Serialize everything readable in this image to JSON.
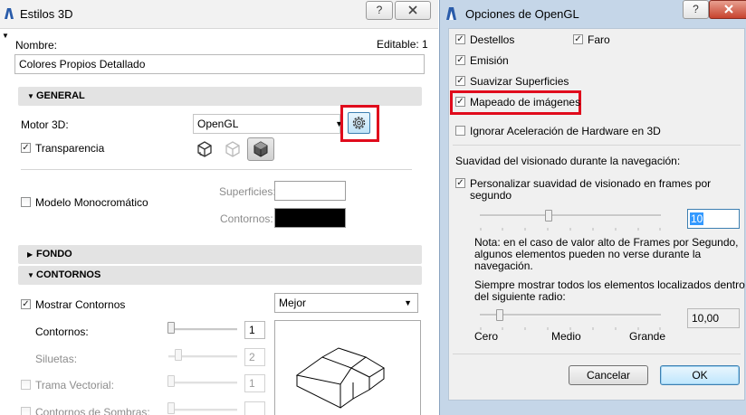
{
  "estilos": {
    "title": "Estilos 3D",
    "help_label": "?",
    "nombre_label": "Nombre:",
    "editable_label": "Editable: 1",
    "nombre_value": "Colores Propios Detallado",
    "general": {
      "header": "GENERAL",
      "motor_label": "Motor 3D:",
      "motor_value": "OpenGL",
      "transparencia_label": "Transparencia",
      "transparencia_checked": "✓",
      "monocromatico_label": "Modelo Monocromático",
      "superficies_label": "Superficies:",
      "contornos_label": "Contornos:",
      "superficies_color": "#ffffff",
      "contornos_color": "#000000"
    },
    "fondo_header": "FONDO",
    "contornos": {
      "header": "CONTORNOS",
      "mostrar_label": "Mostrar Contornos",
      "mostrar_checked": "✓",
      "quality_value": "Mejor",
      "contornos_label": "Contornos:",
      "contornos_value": "1",
      "siluetas_label": "Siluetas:",
      "siluetas_value": "2",
      "trama_label": "Trama Vectorial:",
      "trama_value": "1",
      "sombras_label": "Contornos de Sombras:"
    }
  },
  "opengl": {
    "title": "Opciones de OpenGL",
    "help_label": "?",
    "close_label": "X",
    "destellos_label": "Destellos",
    "faro_label": "Faro",
    "emision_label": "Emisión",
    "suavizar_label": "Suavizar Superficies",
    "mapeado_label": "Mapeado de imágenes",
    "ignorar_label": "Ignorar Aceleración de Hardware en 3D",
    "check_mark": "✓",
    "suavidad_heading": "Suavidad del visionado durante la navegación:",
    "personalizar_line1": "Personalizar suavidad de visionado en frames por",
    "personalizar_line2": "segundo",
    "frames_value": "10",
    "note_line1": "Nota: en el caso de valor alto de Frames por Segundo,",
    "note_line2": "algunos elementos pueden no verse durante la",
    "note_line3": "navegación.",
    "siempre_line1": "Siempre mostrar todos los elementos localizados dentro",
    "siempre_line2": "del siguiente radio:",
    "radio_value": "10,00",
    "scale_low": "Cero",
    "scale_mid": "Medio",
    "scale_high": "Grande",
    "cancel_label": "Cancelar",
    "ok_label": "OK"
  },
  "colors": {
    "highlight_red": "#e00b1c",
    "selection_blue": "#3399ff",
    "window_frame": "#c5d6e8"
  }
}
